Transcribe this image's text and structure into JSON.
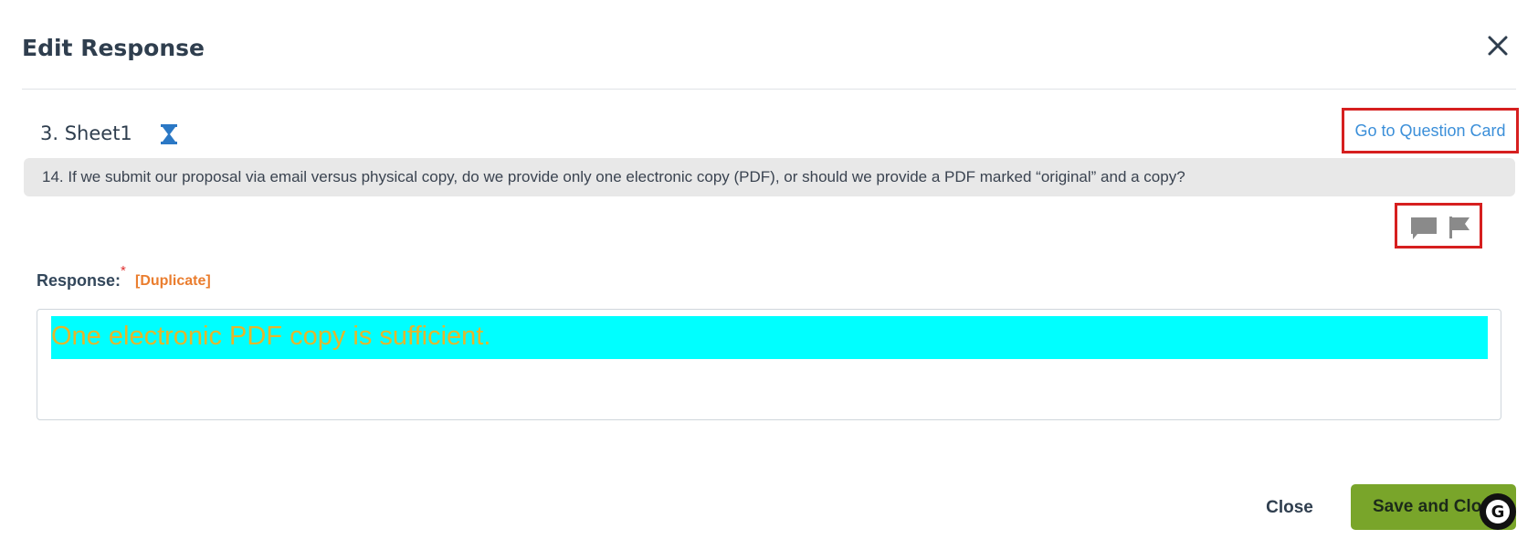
{
  "modal": {
    "title": "Edit Response",
    "close_icon": "close-icon"
  },
  "section": {
    "title": "3. Sheet1",
    "status_icon": "hourglass-icon",
    "status_color": "#2b78c5",
    "goto_link": "Go to Question Card"
  },
  "question": {
    "text": "14. If we submit our proposal via email versus physical copy, do we provide only one electronic copy (PDF), or should we provide a PDF marked “original” and a copy?"
  },
  "actions": {
    "comment_icon": "comment-icon",
    "flag_icon": "flag-icon"
  },
  "response": {
    "label": "Response:",
    "required_mark": "*",
    "tag": "[Duplicate]",
    "text": "One electronic PDF copy is sufficient.",
    "highlight_color": "#00ffff",
    "text_color": "#e4b62c"
  },
  "footer": {
    "close_label": "Close",
    "save_label": "Save and Close",
    "save_color": "#79a52a",
    "grammarly_letter": "G"
  },
  "colors": {
    "link": "#3b8fd9",
    "annotation_box": "#d61f1f",
    "tag": "#ea7d2e"
  }
}
